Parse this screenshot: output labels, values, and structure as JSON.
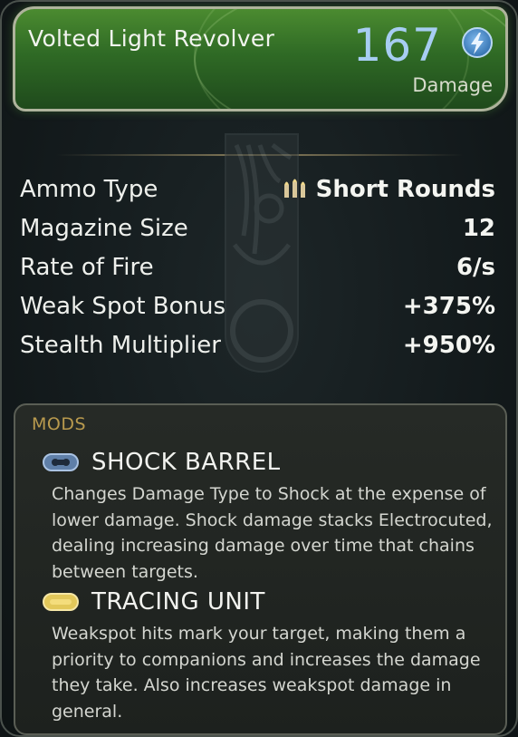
{
  "weapon": {
    "name": "Volted Light Revolver",
    "damage_value": "167",
    "damage_label": "Damage",
    "damage_type_icon": "lightning-bolt-icon",
    "rarity_color": "#3f7f2c"
  },
  "stats": [
    {
      "label": "Ammo Type",
      "value": "Short Rounds",
      "icon": "short-rounds-ammo-icon"
    },
    {
      "label": "Magazine Size",
      "value": "12"
    },
    {
      "label": "Rate of Fire",
      "value": "6/s"
    },
    {
      "label": "Weak Spot Bonus",
      "value": "+375%"
    },
    {
      "label": "Stealth Multiplier",
      "value": "+950%"
    }
  ],
  "mods": {
    "header": "MODS",
    "items": [
      {
        "name": "SHOCK BARREL",
        "icon": "shock-barrel-mod-icon",
        "description": "Changes Damage Type to Shock at the expense of lower damage. Shock damage stacks Electrocuted, dealing increasing damage over time that chains between targets."
      },
      {
        "name": "TRACING UNIT",
        "icon": "tracing-unit-mod-icon",
        "description": "Weakspot hits mark your target, making them a priority to companions and increases the damage they take. Also increases weakspot damage in general."
      }
    ]
  }
}
